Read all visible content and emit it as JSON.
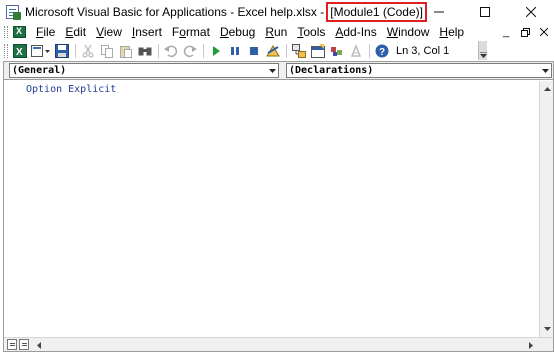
{
  "window": {
    "title_prefix": "Microsoft Visual Basic for Applications - Excel help.xlsx - ",
    "title_module": "[Module1 (Code)]",
    "minimize": "—",
    "restore": "☐",
    "close": "✕"
  },
  "menu": {
    "items": [
      {
        "label": "File",
        "accel": "F",
        "rest": "ile"
      },
      {
        "label": "Edit",
        "accel": "E",
        "rest": "dit"
      },
      {
        "label": "View",
        "accel": "V",
        "rest": "iew"
      },
      {
        "label": "Insert",
        "accel": "I",
        "rest": "nsert"
      },
      {
        "label": "Format",
        "accel": "o",
        "pre": "F",
        "rest": "rmat"
      },
      {
        "label": "Debug",
        "accel": "D",
        "rest": "ebug"
      },
      {
        "label": "Run",
        "accel": "R",
        "rest": "un"
      },
      {
        "label": "Tools",
        "accel": "T",
        "rest": "ools"
      },
      {
        "label": "Add-Ins",
        "accel": "A",
        "rest": "dd-Ins"
      },
      {
        "label": "Window",
        "accel": "W",
        "rest": "indow"
      },
      {
        "label": "Help",
        "accel": "H",
        "rest": "elp"
      }
    ],
    "mdi_minimize": "_",
    "mdi_restore": "🗗",
    "mdi_close": "✕"
  },
  "toolbar": {
    "icons": [
      "view-excel-icon",
      "insert-module-icon",
      "save-icon",
      "cut-icon",
      "copy-icon",
      "paste-icon",
      "find-icon",
      "undo-icon",
      "redo-icon",
      "run-icon",
      "break-icon",
      "reset-icon",
      "design-mode-icon",
      "project-explorer-icon",
      "properties-icon",
      "object-browser-icon",
      "toolbox-icon",
      "help-icon"
    ],
    "status": "Ln 3, Col 1"
  },
  "code_window": {
    "object_combo": "(General)",
    "procedure_combo": "(Declarations)",
    "code_lines": [
      "Option Explicit"
    ]
  },
  "colors": {
    "highlight_border": "#e02020",
    "keyword_blue": "#1f3c9a"
  }
}
